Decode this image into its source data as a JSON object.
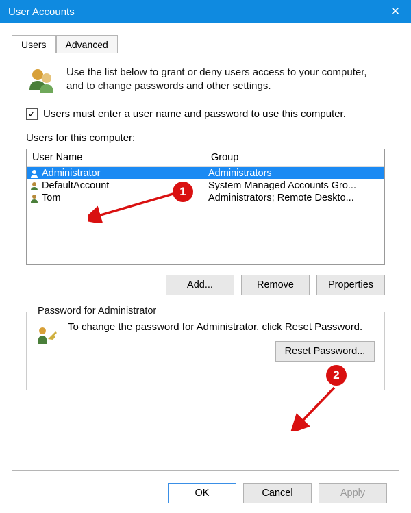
{
  "title": "User Accounts",
  "tabs": {
    "users": "Users",
    "advanced": "Advanced"
  },
  "intro": "Use the list below to grant or deny users access to your computer, and to change passwords and other settings.",
  "checkbox_label": "Users must enter a user name and password to use this computer.",
  "checkbox_checked": "✓",
  "list_label": "Users for this computer:",
  "columns": {
    "username": "User Name",
    "group": "Group"
  },
  "rows": [
    {
      "username": "Administrator",
      "group": "Administrators",
      "selected": true
    },
    {
      "username": "DefaultAccount",
      "group": "System Managed Accounts Gro...",
      "selected": false
    },
    {
      "username": "Tom",
      "group": "Administrators; Remote Deskto...",
      "selected": false
    }
  ],
  "buttons": {
    "add": "Add...",
    "remove": "Remove",
    "properties": "Properties"
  },
  "fieldset": {
    "legend": "Password for Administrator",
    "text": "To change the password for Administrator, click Reset Password.",
    "reset": "Reset Password..."
  },
  "dialog_buttons": {
    "ok": "OK",
    "cancel": "Cancel",
    "apply": "Apply"
  },
  "annotations": {
    "one": "1",
    "two": "2"
  }
}
